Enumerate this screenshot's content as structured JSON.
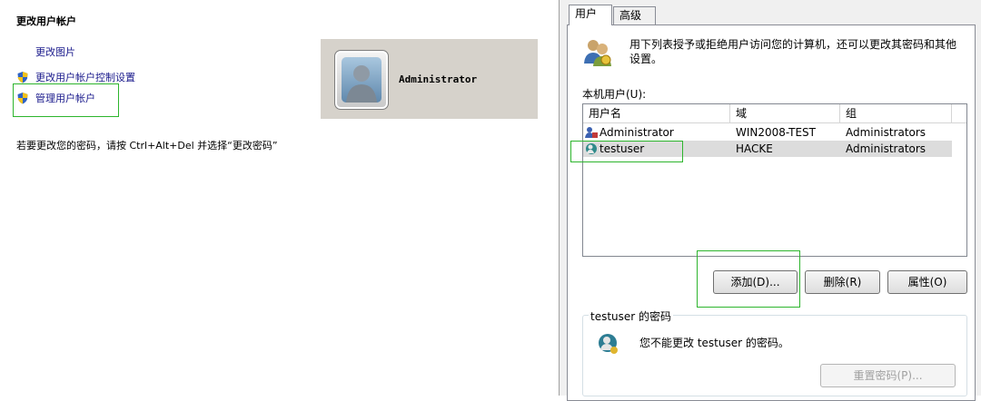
{
  "left": {
    "title": "更改用户帐户",
    "links": {
      "change_picture": "更改图片",
      "uac_settings": "更改用户帐户控制设置",
      "manage_accounts": "管理用户帐户"
    },
    "account_tile": {
      "name": "Administrator"
    },
    "password_note": "若要更改您的密码，请按 Ctrl+Alt+Del 并选择“更改密码”"
  },
  "dialog": {
    "tabs": [
      {
        "label": "用户"
      },
      {
        "label": "高级"
      }
    ],
    "description": "用下列表授予或拒绝用户访问您的计算机，还可以更改其密码和其他设置。",
    "list_label": "本机用户(U):",
    "columns": [
      "用户名",
      "域",
      "组"
    ],
    "rows": [
      {
        "name": "Administrator",
        "domain": "WIN2008-TEST",
        "group": "Administrators",
        "icon": "admin-user-icon"
      },
      {
        "name": "testuser",
        "domain": "HACKE",
        "group": "Administrators",
        "icon": "domain-user-icon"
      }
    ],
    "buttons": {
      "add": "添加(D)...",
      "remove": "删除(R)",
      "properties": "属性(O)"
    },
    "password_group": {
      "title": "testuser 的密码",
      "message": "您不能更改 testuser 的密码。",
      "reset": "重置密码(P)..."
    }
  }
}
